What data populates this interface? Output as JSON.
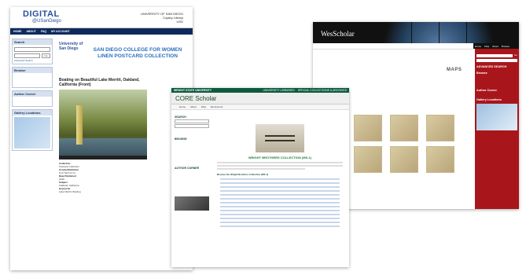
{
  "usd": {
    "logo_main": "DIGITAL",
    "logo_sub": "@USanDiego",
    "university": "UNIVERSITY OF SAN DIEGO",
    "uni_sub1": "Copley Library",
    "uni_sub2": "USD",
    "nav": [
      "HOME",
      "ABOUT",
      "FAQ",
      "MY ACCOUNT"
    ],
    "search_title": "Search",
    "search_go": "Go",
    "advanced_search": "Advanced Search",
    "browse_title": "Browse",
    "author_corner": "Author Corner",
    "gallery_title": "Gallery Locations",
    "logo_university": "University of San Diego",
    "collection_title": "SAN DIEGO COLLEGE FOR WOMEN LINEN POSTCARD COLLECTION",
    "item_title": "Boating on Beautiful Lake Merritt, Oakland, California (Front)",
    "meta_keys": [
      "Collection",
      "Creator/Publisher",
      "Date Published",
      "Subject",
      "Keywords"
    ],
    "meta_vals": [
      "Postcard Collection",
      "Curt Teich & Co.",
      "1940",
      "Oakland, California",
      "Lake Merritt; Boating"
    ]
  },
  "wes": {
    "title": "WesScholar",
    "maps_heading": "MAPS",
    "rnav": [
      "Home",
      "FAQ",
      "About",
      "Browse"
    ],
    "go": "Go",
    "advanced_search": "ADVANCED SEARCH",
    "browse": "Browse",
    "author_corner": "Author Corner",
    "gallery": "Gallery Locations"
  },
  "core": {
    "university": "WRIGHT STATE UNIVERSITY",
    "top_links": [
      "UNIVERSITY LIBRARIES",
      "SPECIAL COLLECTIONS & ARCHIVES"
    ],
    "title": "CORE Scholar",
    "nav": [
      "Home",
      "About",
      "FAQ",
      "My Account"
    ],
    "search": "SEARCH",
    "browse": "BROWSE",
    "author_corner": "AUTHOR CORNER",
    "collection_title": "WRIGHT BROTHERS COLLECTION (MS-1)",
    "list_heading": "Browse the Wright Brothers Collection (MS-1)"
  }
}
